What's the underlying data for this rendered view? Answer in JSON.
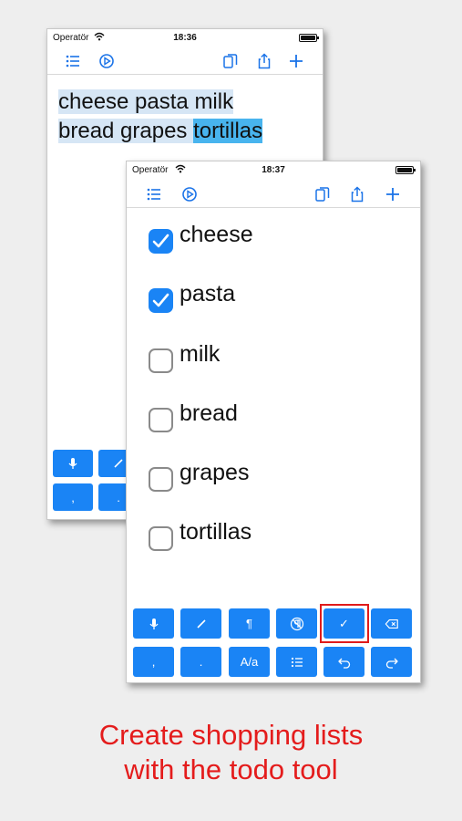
{
  "back_screen": {
    "status": {
      "carrier": "Operatör",
      "time": "18:36"
    },
    "toolbar_icons": [
      "list-icon",
      "play-circle-icon",
      "copy-icon",
      "share-icon",
      "plus-icon"
    ],
    "text_lines": [
      [
        {
          "text": "cheese pasta milk",
          "style": "hl"
        }
      ],
      [
        {
          "text": "bread grapes ",
          "style": "hl"
        },
        {
          "text": "tortillas",
          "style": "hl-strong"
        }
      ]
    ],
    "keys_visible": [
      ",",
      "."
    ]
  },
  "front_screen": {
    "status": {
      "carrier": "Operatör",
      "time": "18:37"
    },
    "toolbar_icons": [
      "list-icon",
      "play-circle-icon",
      "copy-icon",
      "share-icon",
      "plus-icon"
    ],
    "todos": [
      {
        "label": "cheese",
        "checked": true
      },
      {
        "label": "pasta",
        "checked": true
      },
      {
        "label": "milk",
        "checked": false
      },
      {
        "label": "bread",
        "checked": false
      },
      {
        "label": "grapes",
        "checked": false
      },
      {
        "label": "tortillas",
        "checked": false
      }
    ],
    "keyboard": {
      "row1": [
        "mic-icon",
        "slash-icon",
        "¶",
        "no-paragraph-icon",
        "✓",
        "delete-icon"
      ],
      "row2": [
        ",",
        ".",
        "A/a",
        "list-icon",
        "undo-icon",
        "redo-icon"
      ]
    }
  },
  "caption": {
    "line1": "Create shopping lists",
    "line2": "with the todo tool"
  },
  "colors": {
    "accent": "#1a84f5",
    "caption": "#e41c1c",
    "arrow": "#e41c1c"
  }
}
